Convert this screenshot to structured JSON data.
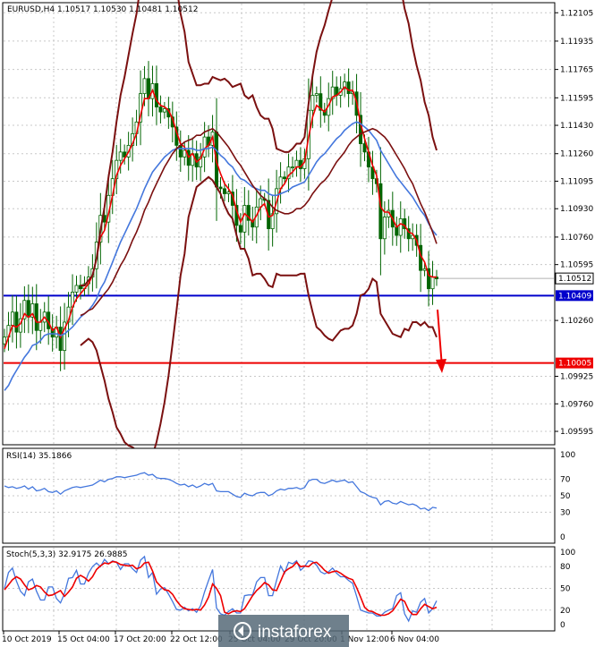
{
  "chart_data": {
    "type": "candlestick",
    "main": {
      "header": "EURUSD,H4  1.10517 1.10530 1.10481 1.10512",
      "y_range": [
        1.0952,
        1.1216
      ],
      "y_ticks": [
        "1.12105",
        "1.11935",
        "1.11765",
        "1.11595",
        "1.11430",
        "1.11260",
        "1.11095",
        "1.10930",
        "1.10760",
        "1.10595",
        "1.10260",
        "1.09925",
        "1.09760",
        "1.09595"
      ],
      "current_price": "1.10512",
      "levels": [
        {
          "label": "1.10409",
          "value": 1.10409,
          "color": "#0000cc"
        },
        {
          "label": "1.10005",
          "value": 1.10005,
          "color": "#ee0000"
        }
      ],
      "close": [
        1.1016,
        1.1023,
        1.1031,
        1.1019,
        1.1027,
        1.1038,
        1.1028,
        1.1036,
        1.102,
        1.1025,
        1.1031,
        1.1021,
        1.1016,
        1.1022,
        1.1008,
        1.1025,
        1.1034,
        1.1043,
        1.1047,
        1.1045,
        1.1048,
        1.1052,
        1.1057,
        1.1073,
        1.1089,
        1.1085,
        1.1101,
        1.1111,
        1.1122,
        1.1127,
        1.1124,
        1.1131,
        1.1138,
        1.1145,
        1.1162,
        1.1171,
        1.1159,
        1.1168,
        1.1154,
        1.1151,
        1.1153,
        1.1148,
        1.1142,
        1.1131,
        1.1124,
        1.1128,
        1.1119,
        1.1126,
        1.1118,
        1.1124,
        1.1136,
        1.1131,
        1.1139,
        1.1106,
        1.1105,
        1.1102,
        1.1103,
        1.1095,
        1.1083,
        1.1079,
        1.1095,
        1.1086,
        1.1082,
        1.1094,
        1.1099,
        1.1098,
        1.1081,
        1.109,
        1.1105,
        1.1112,
        1.1111,
        1.1118,
        1.1118,
        1.1122,
        1.1117,
        1.1123,
        1.1152,
        1.1161,
        1.1162,
        1.1152,
        1.1149,
        1.1159,
        1.1166,
        1.1161,
        1.1165,
        1.1169,
        1.1162,
        1.1163,
        1.1149,
        1.1132,
        1.1127,
        1.1118,
        1.1111,
        1.1108,
        1.1075,
        1.1088,
        1.1092,
        1.1082,
        1.1077,
        1.1087,
        1.1081,
        1.1075,
        1.1077,
        1.1071,
        1.1056,
        1.1057,
        1.1045,
        1.1052,
        1.1051
      ],
      "series": [
        {
          "name": "ma_fast",
          "color": "#ee0000",
          "values": [
            1.1009,
            1.1016,
            1.1023,
            1.1022,
            1.1024,
            1.103,
            1.1028,
            1.103,
            1.1025,
            1.1025,
            1.1028,
            1.1025,
            1.102,
            1.1022,
            1.1016,
            1.1021,
            1.1026,
            1.1034,
            1.1039,
            1.1042,
            1.1045,
            1.1048,
            1.1053,
            1.1063,
            1.1076,
            1.108,
            1.109,
            1.1101,
            1.1113,
            1.1119,
            1.1123,
            1.1127,
            1.1132,
            1.1138,
            1.1149,
            1.1159,
            1.1159,
            1.1164,
            1.1158,
            1.1155,
            1.1154,
            1.1152,
            1.1147,
            1.1139,
            1.1132,
            1.113,
            1.1124,
            1.1126,
            1.1121,
            1.1123,
            1.1129,
            1.1131,
            1.1136,
            1.1121,
            1.1114,
            1.1108,
            1.1105,
            1.1101,
            1.1092,
            1.1085,
            1.109,
            1.1088,
            1.1085,
            1.1089,
            1.1094,
            1.1096,
            1.1088,
            1.1089,
            1.1097,
            1.1105,
            1.1108,
            1.1113,
            1.1115,
            1.1118,
            1.1118,
            1.1121,
            1.1136,
            1.1148,
            1.1155,
            1.1153,
            1.1151,
            1.1155,
            1.116,
            1.1161,
            1.1163,
            1.1166,
            1.1164,
            1.1164,
            1.1157,
            1.1144,
            1.1135,
            1.1127,
            1.1119,
            1.1113,
            1.1094,
            1.1091,
            1.1091,
            1.1087,
            1.1082,
            1.1084,
            1.1083,
            1.1079,
            1.1078,
            1.1074,
            1.1065,
            1.1061,
            1.1053,
            1.1052,
            1.1052
          ]
        },
        {
          "name": "ma_slow",
          "color": "#4477dd",
          "values": [
            1.0984,
            1.0987,
            1.0992,
            1.0996,
            1.1,
            1.1004,
            1.1007,
            1.1011,
            1.1012,
            1.1014,
            1.1017,
            1.1018,
            1.1018,
            1.1018,
            1.1017,
            1.1018,
            1.102,
            1.1022,
            1.1025,
            1.1028,
            1.103,
            1.1032,
            1.1035,
            1.1039,
            1.1045,
            1.1049,
            1.1055,
            1.1061,
            1.1067,
            1.1073,
            1.1078,
            1.1083,
            1.1088,
            1.1093,
            1.1099,
            1.1105,
            1.111,
            1.1115,
            1.1118,
            1.1121,
            1.1124,
            1.1126,
            1.1128,
            1.1129,
            1.1129,
            1.1129,
            1.1129,
            1.1129,
            1.1128,
            1.1128,
            1.1129,
            1.1129,
            1.113,
            1.1128,
            1.1125,
            1.1123,
            1.112,
            1.1118,
            1.1114,
            1.1111,
            1.111,
            1.1108,
            1.1106,
            1.1105,
            1.1104,
            1.1104,
            1.1102,
            1.1101,
            1.1101,
            1.1102,
            1.1103,
            1.1104,
            1.1106,
            1.1107,
            1.1108,
            1.1109,
            1.1113,
            1.1117,
            1.1121,
            1.1124,
            1.1126,
            1.1129,
            1.1132,
            1.1135,
            1.1137,
            1.114,
            1.1142,
            1.1144,
            1.1145,
            1.1144,
            1.1142,
            1.114,
            1.1137,
            1.1134,
            1.1128,
            1.1124,
            1.112,
            1.1116,
            1.1112,
            1.1109,
            1.1106,
            1.1103,
            1.11,
            1.1096,
            1.1092,
            1.1089,
            1.1084,
            1.108,
            1.1077
          ]
        },
        {
          "name": "ma_bb_mid",
          "color": "#7b1010",
          "values": [
            null,
            null,
            null,
            null,
            null,
            null,
            null,
            null,
            null,
            null,
            null,
            null,
            null,
            null,
            null,
            null,
            null,
            null,
            null,
            1.1029,
            1.103,
            1.1032,
            1.1033,
            1.1036,
            1.1039,
            1.1042,
            1.1045,
            1.1049,
            1.1054,
            1.1059,
            1.1063,
            1.1068,
            1.1074,
            1.1079,
            1.1085,
            1.1092,
            1.1097,
            1.1103,
            1.1108,
            1.1113,
            1.1118,
            1.1122,
            1.1126,
            1.1129,
            1.1131,
            1.1133,
            1.1134,
            1.1135,
            1.1137,
            1.1137,
            1.1139,
            1.114,
            1.1141,
            1.1139,
            1.1136,
            1.1133,
            1.113,
            1.1126,
            1.1122,
            1.1119,
            1.1115,
            1.1111,
            1.1107,
            1.1104,
            1.1101,
            1.1099,
            1.1097,
            1.1094,
            1.1092,
            1.1091,
            1.109,
            1.109,
            1.1091,
            1.1093,
            1.1093,
            1.1095,
            1.1098,
            1.1102,
            1.1105,
            1.1108,
            1.111,
            1.1113,
            1.1117,
            1.1121,
            1.1124,
            1.1127,
            1.1131,
            1.1134,
            1.1136,
            1.1138,
            1.1139,
            1.114,
            1.1141,
            1.114,
            1.1138,
            1.1136,
            1.1133,
            1.1129,
            1.1125,
            1.1121,
            1.1117,
            1.1112,
            1.1108,
            1.1102,
            1.1096,
            1.1091,
            1.1085,
            1.1079,
            1.1072
          ]
        },
        {
          "name": "bb_upper",
          "color": "#7b1010",
          "values": [
            null,
            null,
            null,
            null,
            null,
            null,
            null,
            null,
            null,
            null,
            null,
            null,
            null,
            null,
            null,
            null,
            null,
            null,
            null,
            1.1047,
            1.1047,
            1.105,
            1.1053,
            1.1063,
            1.108,
            1.1094,
            1.1112,
            1.1127,
            1.1145,
            1.1161,
            1.1172,
            1.1185,
            1.1198,
            1.121,
            1.1227,
            1.1242,
            1.125,
            1.126,
            1.1263,
            1.1262,
            1.1259,
            1.1251,
            1.124,
            1.1226,
            1.121,
            1.1199,
            1.1181,
            1.1174,
            1.1167,
            1.1167,
            1.1168,
            1.1168,
            1.1172,
            1.1171,
            1.117,
            1.1171,
            1.1169,
            1.1166,
            1.1167,
            1.1168,
            1.1161,
            1.1159,
            1.1161,
            1.1154,
            1.1149,
            1.1147,
            1.1147,
            1.1141,
            1.1129,
            1.1128,
            1.1127,
            1.1127,
            1.1129,
            1.1132,
            1.1132,
            1.1136,
            1.1156,
            1.1173,
            1.1187,
            1.1196,
            1.1203,
            1.1212,
            1.122,
            1.1225,
            1.1229,
            1.1234,
            1.124,
            1.1244,
            1.1243,
            1.1238,
            1.1236,
            1.1234,
            1.1231,
            1.1231,
            1.1246,
            1.1246,
            1.1244,
            1.1241,
            1.1233,
            1.1226,
            1.1213,
            1.1204,
            1.119,
            1.1179,
            1.117,
            1.1157,
            1.1149,
            1.1136,
            1.1128
          ]
        },
        {
          "name": "bb_lower",
          "color": "#7b1010",
          "values": [
            null,
            null,
            null,
            null,
            null,
            null,
            null,
            null,
            null,
            null,
            null,
            null,
            null,
            null,
            null,
            null,
            null,
            null,
            null,
            1.1011,
            1.1013,
            1.1015,
            1.1013,
            1.1008,
            1.0999,
            1.099,
            1.0979,
            1.0971,
            1.0962,
            1.0958,
            1.0953,
            1.0951,
            1.095,
            1.0948,
            1.0943,
            1.0941,
            1.0944,
            1.0945,
            1.0953,
            1.0964,
            1.0977,
            1.0993,
            1.1012,
            1.1032,
            1.1053,
            1.1066,
            1.1088,
            1.1097,
            1.1106,
            1.1108,
            1.111,
            1.1112,
            1.111,
            1.1106,
            1.1102,
            1.1095,
            1.109,
            1.1087,
            1.1077,
            1.1069,
            1.1069,
            1.1063,
            1.1053,
            1.1054,
            1.1054,
            1.1051,
            1.1047,
            1.1046,
            1.1054,
            1.1053,
            1.1053,
            1.1053,
            1.1053,
            1.1053,
            1.1054,
            1.1054,
            1.1041,
            1.1031,
            1.1022,
            1.102,
            1.1017,
            1.1015,
            1.1014,
            1.1017,
            1.102,
            1.1021,
            1.1021,
            1.1023,
            1.103,
            1.1041,
            1.1042,
            1.1045,
            1.1051,
            1.1049,
            1.103,
            1.1026,
            1.1022,
            1.1018,
            1.1017,
            1.1016,
            1.1021,
            1.102,
            1.1025,
            1.1025,
            1.1023,
            1.1025,
            1.1022,
            1.1022,
            1.1016
          ]
        }
      ]
    },
    "rsi": {
      "label": "RSI(14) 35.1866",
      "y_range": [
        0,
        100
      ],
      "y_ticks": [
        "100",
        "70",
        "50",
        "30",
        "0"
      ],
      "values": [
        62,
        60,
        61,
        59,
        60,
        62,
        58,
        61,
        56,
        57,
        59,
        55,
        54,
        56,
        52,
        56,
        58,
        60,
        61,
        60,
        61,
        62,
        63,
        66,
        69,
        67,
        70,
        71,
        73,
        73,
        72,
        73,
        74,
        75,
        77,
        78,
        75,
        76,
        72,
        71,
        71,
        70,
        68,
        65,
        63,
        64,
        61,
        63,
        60,
        62,
        65,
        63,
        65,
        56,
        55,
        55,
        55,
        52,
        49,
        48,
        53,
        51,
        50,
        53,
        54,
        54,
        50,
        52,
        56,
        58,
        57,
        59,
        59,
        60,
        58,
        60,
        68,
        70,
        70,
        66,
        65,
        67,
        69,
        67,
        68,
        69,
        66,
        67,
        61,
        55,
        53,
        50,
        48,
        47,
        39,
        43,
        44,
        41,
        40,
        43,
        41,
        39,
        40,
        38,
        34,
        35,
        32,
        36,
        35
      ]
    },
    "stoch": {
      "label": "Stoch(5,3,3) 32.9175 26.9885",
      "y_range": [
        0,
        100
      ],
      "y_ticks": [
        "100",
        "80",
        "50",
        "20",
        "0"
      ],
      "series": [
        {
          "name": "main",
          "color": "#4477dd",
          "values": [
            50,
            72,
            78,
            60,
            46,
            40,
            59,
            63,
            46,
            34,
            34,
            52,
            52,
            36,
            30,
            43,
            64,
            65,
            75,
            56,
            56,
            71,
            80,
            85,
            80,
            90,
            84,
            88,
            86,
            76,
            84,
            84,
            77,
            72,
            89,
            94,
            65,
            72,
            42,
            49,
            51,
            42,
            32,
            21,
            20,
            24,
            19,
            22,
            17,
            26,
            45,
            61,
            76,
            23,
            15,
            13,
            18,
            22,
            16,
            16,
            40,
            41,
            41,
            59,
            65,
            65,
            40,
            40,
            61,
            81,
            71,
            86,
            84,
            88,
            75,
            80,
            88,
            87,
            82,
            73,
            70,
            73,
            78,
            71,
            66,
            66,
            61,
            57,
            39,
            20,
            18,
            16,
            16,
            12,
            12,
            17,
            20,
            22,
            40,
            44,
            15,
            5,
            19,
            17,
            31,
            36,
            16,
            22,
            33
          ]
        },
        {
          "name": "signal",
          "color": "#ee0000",
          "values": [
            48,
            55,
            62,
            66,
            63,
            55,
            48,
            50,
            54,
            52,
            45,
            40,
            41,
            44,
            47,
            39,
            45,
            52,
            64,
            68,
            65,
            60,
            66,
            76,
            81,
            85,
            84,
            87,
            86,
            83,
            82,
            81,
            82,
            77,
            79,
            85,
            86,
            74,
            59,
            53,
            48,
            47,
            42,
            33,
            26,
            22,
            21,
            20,
            21,
            20,
            27,
            38,
            56,
            50,
            40,
            17,
            15,
            18,
            19,
            18,
            22,
            31,
            40,
            47,
            52,
            58,
            55,
            48,
            47,
            60,
            73,
            77,
            80,
            86,
            80,
            81,
            80,
            85,
            86,
            81,
            75,
            71,
            73,
            74,
            71,
            67,
            64,
            62,
            51,
            38,
            24,
            19,
            18,
            15,
            13,
            13,
            15,
            19,
            27,
            35,
            32,
            20,
            14,
            14,
            22,
            28,
            25,
            22,
            24
          ]
        }
      ]
    },
    "x_labels": [
      "10 Oct 2019",
      "15 Oct 04:00",
      "17 Oct 20:00",
      "22 Oct 12:00",
      "25 Oct 04:00",
      "29 Oct 20:00",
      "1 Nov 12:00",
      "6 Nov 04:00"
    ]
  },
  "watermark": "instaforex"
}
